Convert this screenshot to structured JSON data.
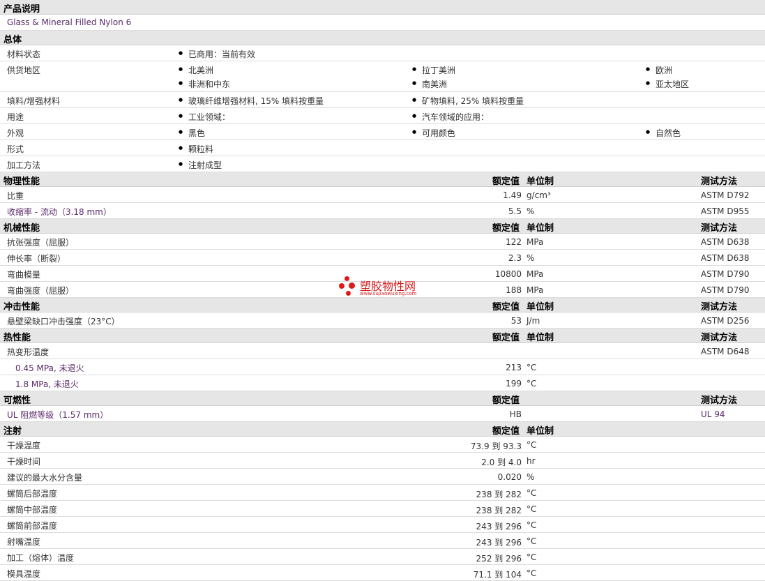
{
  "product": {
    "header": "产品说明",
    "description": "Glass & Mineral Filled Nylon 6"
  },
  "general": {
    "header": "总体",
    "status_label": "材料状态",
    "status_value": "已商用：当前有效",
    "availability_label": "供货地区",
    "regions": [
      "北美洲",
      "拉丁美洲",
      "欧洲",
      "非洲和中东",
      "南美洲",
      "亚太地区"
    ],
    "filler_label": "填料/增强材料",
    "fillers": [
      "玻璃纤维增强材料, 15% 填料按重量",
      "矿物填料, 25% 填料按重量"
    ],
    "uses_label": "用途",
    "uses": [
      "工业领域：",
      "汽车领域的应用："
    ],
    "appearance_label": "外观",
    "appearance": [
      "黑色",
      "可用颜色",
      "自然色"
    ],
    "form_label": "形式",
    "form": "颗粒料",
    "processing_label": "加工方法",
    "processing": "注射成型"
  },
  "columns": {
    "nominal": "额定值",
    "unit": "单位制",
    "method": "测试方法"
  },
  "physical": {
    "header": "物理性能",
    "rows": [
      {
        "label": "比重",
        "value": "1.49",
        "unit": "g/cm³",
        "method": "ASTM D792"
      },
      {
        "label": "收缩率 - 流动（3.18 mm）",
        "value": "5.5",
        "unit": "%",
        "method": "ASTM D955"
      }
    ]
  },
  "mechanical": {
    "header": "机械性能",
    "rows": [
      {
        "label": "抗张强度（屈服）",
        "value": "122",
        "unit": "MPa",
        "method": "ASTM D638"
      },
      {
        "label": "伸长率（断裂）",
        "value": "2.3",
        "unit": "%",
        "method": "ASTM D638"
      },
      {
        "label": "弯曲模量",
        "value": "10800",
        "unit": "MPa",
        "method": "ASTM D790"
      },
      {
        "label": "弯曲强度（屈服）",
        "value": "188",
        "unit": "MPa",
        "method": "ASTM D790"
      }
    ]
  },
  "impact": {
    "header": "冲击性能",
    "rows": [
      {
        "label": "悬壁梁缺口冲击强度（23°C）",
        "value": "53",
        "unit": "J/m",
        "method": "ASTM D256"
      }
    ]
  },
  "thermal": {
    "header": "热性能",
    "hdt_label": "热变形温度",
    "hdt_method": "ASTM D648",
    "rows": [
      {
        "label": "0.45 MPa, 未退火",
        "value": "213",
        "unit": "°C"
      },
      {
        "label": "1.8 MPa, 未退火",
        "value": "199",
        "unit": "°C"
      }
    ]
  },
  "flammability": {
    "header": "可燃性",
    "rows": [
      {
        "label": "UL 阻燃等级（1.57 mm）",
        "value": "HB",
        "method": "UL 94"
      }
    ]
  },
  "injection": {
    "header": "注射",
    "rows": [
      {
        "label": "干燥温度",
        "value": "73.9 到  93.3",
        "unit": "°C"
      },
      {
        "label": "干燥时间",
        "value": "2.0 到  4.0",
        "unit": "hr"
      },
      {
        "label": "建议的最大水分含量",
        "value": "0.020",
        "unit": "%"
      },
      {
        "label": "螺筒后部温度",
        "value": "238 到  282",
        "unit": "°C"
      },
      {
        "label": "螺筒中部温度",
        "value": "238 到  282",
        "unit": "°C"
      },
      {
        "label": "螺筒前部温度",
        "value": "243 到  296",
        "unit": "°C"
      },
      {
        "label": "射嘴温度",
        "value": "243 到  296",
        "unit": "°C"
      },
      {
        "label": "加工（熔体）温度",
        "value": "252 到  296",
        "unit": "°C"
      },
      {
        "label": "模具温度",
        "value": "71.1 到  104",
        "unit": "°C"
      }
    ]
  },
  "watermark": {
    "text": "塑胶物性网",
    "url": "www.sujiaowuxing.com"
  }
}
